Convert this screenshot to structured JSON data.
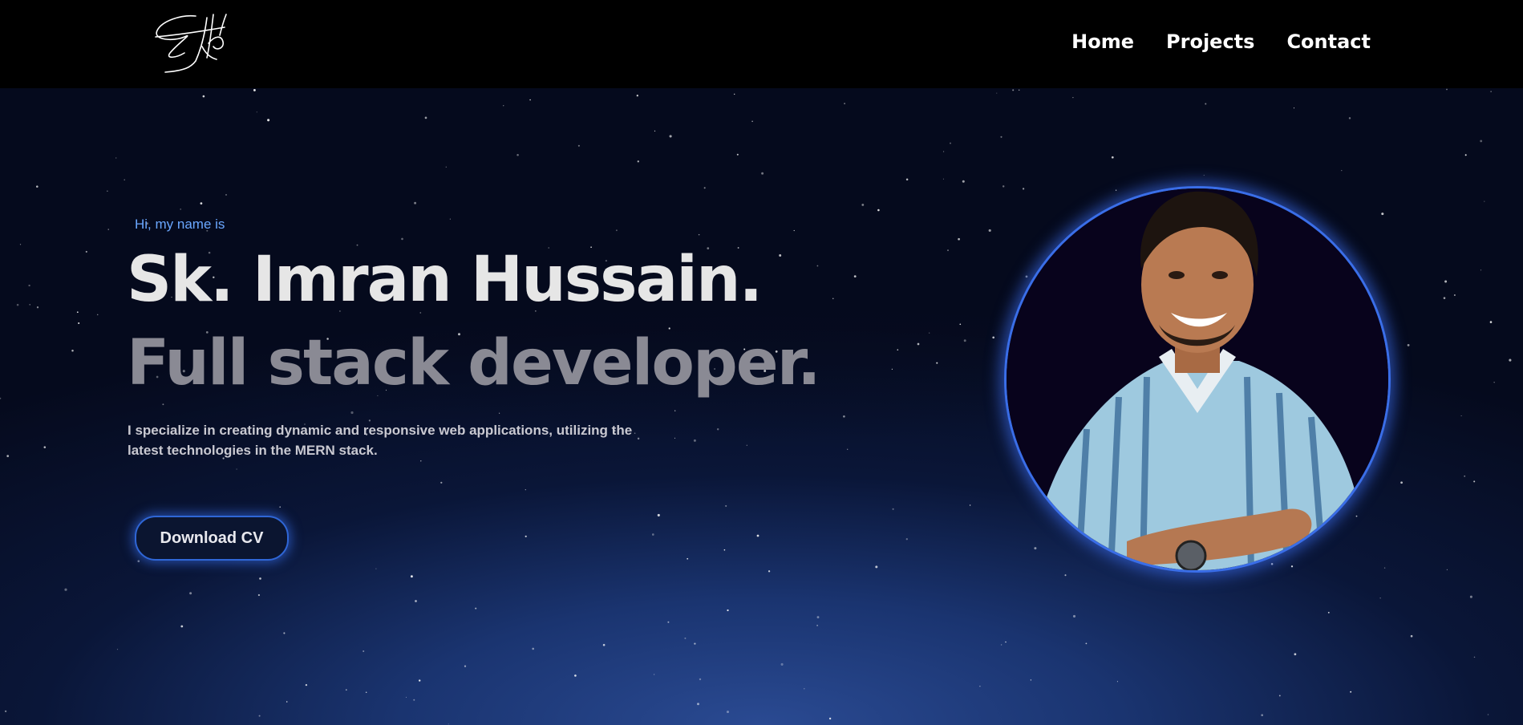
{
  "nav": {
    "logo_icon": "signature-logo",
    "links": [
      "Home",
      "Projects",
      "Contact"
    ]
  },
  "hero": {
    "greeting": "Hi, my name is",
    "name": "Sk. Imran Hussain.",
    "role": "Full stack developer.",
    "bio": "I specialize in creating dynamic and responsive web applications, utilizing the latest technologies in the MERN stack.",
    "cta_label": "Download CV",
    "avatar_icon": "profile-photo"
  },
  "colors": {
    "accent": "#6aa7ff",
    "button_border": "#2f66d6",
    "background": "#050a1d"
  }
}
